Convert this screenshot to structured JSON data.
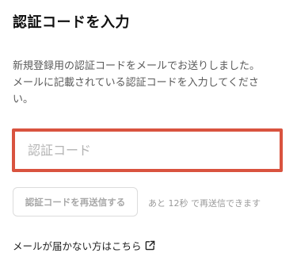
{
  "header": {
    "title": "認証コードを入力"
  },
  "description": {
    "line1": "新規登録用の認証コードをメールでお送りしました。",
    "line2": "メールに記載されている認証コードを入力してくださ",
    "line3": "い。"
  },
  "code_input": {
    "placeholder": "認証コード",
    "value": "",
    "border_color": "#d9533f"
  },
  "resend": {
    "button_label": "認証コードを再送信する",
    "countdown_text": "あと 12秒 で再送信できます"
  },
  "help": {
    "link_label": "メールが届かない方はこちら",
    "icon": "external-link-icon"
  }
}
